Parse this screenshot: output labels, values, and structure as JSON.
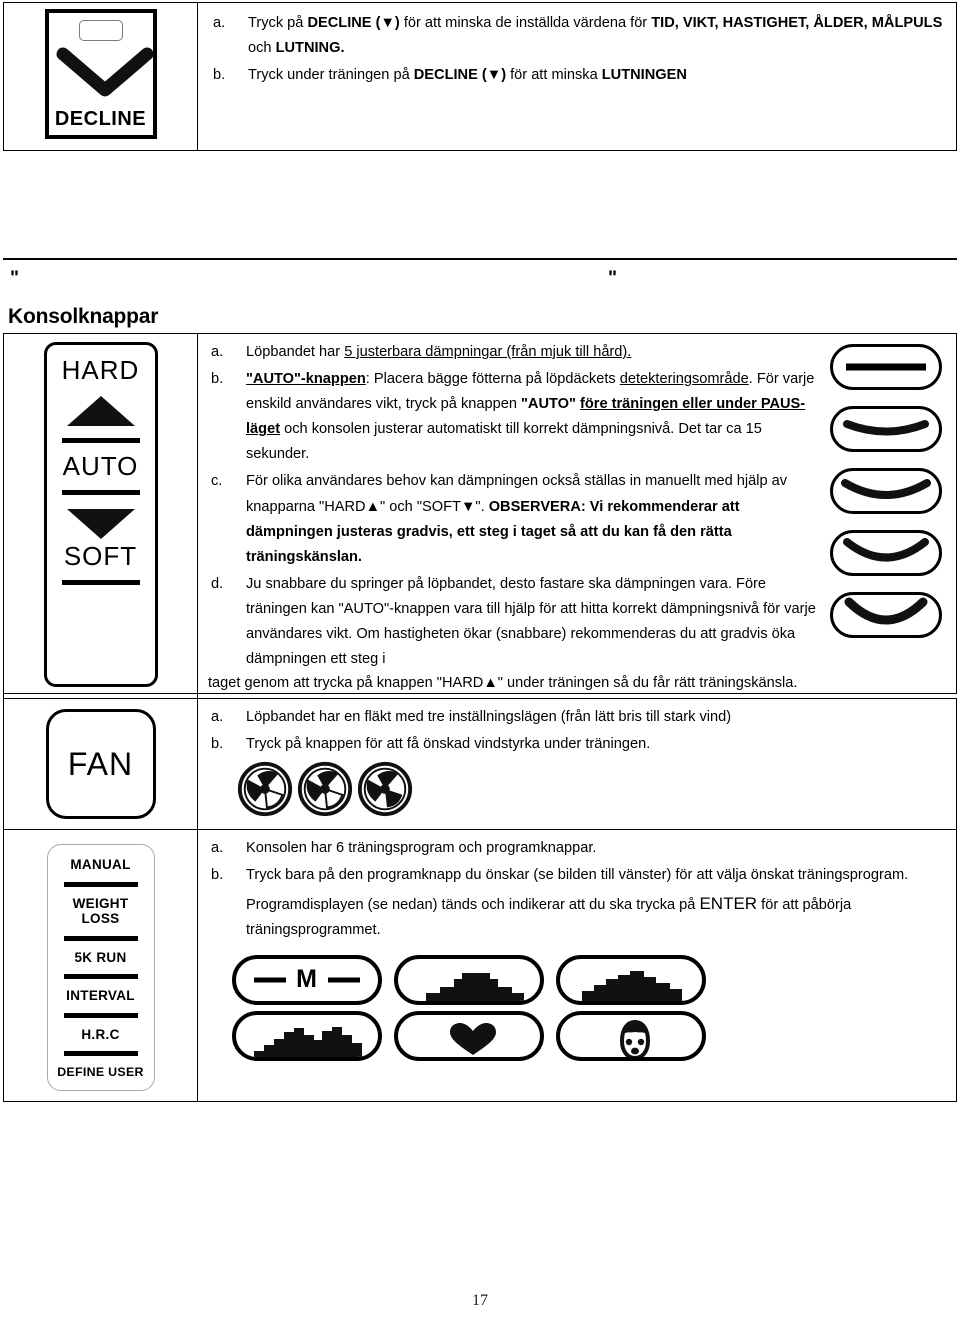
{
  "page": {
    "number": "17",
    "section_heading": "Konsolknappar",
    "quote_left": "\"",
    "quote_right": "\""
  },
  "decline_section": {
    "key_label": "DECLINE",
    "icon": "chevron-down-glyph",
    "items": [
      {
        "mark": "a.",
        "parts": [
          {
            "t": "Tryck på ",
            "b": false
          },
          {
            "t": "DECLINE (",
            "b": true
          },
          {
            "t": "▼",
            "b": true
          },
          {
            "t": ") ",
            "b": true
          },
          {
            "t": "för att minska de inställda värdena för ",
            "b": false
          },
          {
            "t": "TID, VIKT, HASTIGHET, ÅLDER, MÅLPULS",
            "b": true
          },
          {
            "t": " och ",
            "b": false
          },
          {
            "t": "LUTNING.",
            "b": true
          }
        ]
      },
      {
        "mark": "b.",
        "parts": [
          {
            "t": "Tryck under träningen på ",
            "b": false
          },
          {
            "t": "DECLINE (",
            "b": true
          },
          {
            "t": "▼",
            "b": true
          },
          {
            "t": ") ",
            "b": true
          },
          {
            "t": "för att minska ",
            "b": false
          },
          {
            "t": "LUTNINGEN",
            "b": true
          }
        ]
      }
    ]
  },
  "cushion_section": {
    "key": {
      "hard_label": "HARD",
      "auto_label": "AUTO",
      "soft_label": "SOFT",
      "up_icon": "triangle-up-icon",
      "down_icon": "triangle-down-icon"
    },
    "levels": [
      {
        "name": "cushion-level-1-flat"
      },
      {
        "name": "cushion-level-2"
      },
      {
        "name": "cushion-level-3"
      },
      {
        "name": "cushion-level-4"
      },
      {
        "name": "cushion-level-5-soft"
      }
    ],
    "items": [
      {
        "mark": "a.",
        "parts": [
          {
            "t": "Löpbandet har ",
            "b": false
          },
          {
            "t": "5 justerbara dämpningar (från mjuk till hård).",
            "b": false,
            "u": true
          }
        ]
      },
      {
        "mark": "b.",
        "parts": [
          {
            "t": "\"AUTO\"-knappen",
            "b": true,
            "u": true
          },
          {
            "t": ": Placera bägge fötterna på löpdäckets ",
            "b": false
          },
          {
            "t": "detekteringsområde",
            "b": false,
            "u": true
          },
          {
            "t": ". För varje enskild användares vikt, tryck på knappen ",
            "b": false
          },
          {
            "t": "\"AUTO\" ",
            "b": true
          },
          {
            "t": "före träningen eller under PAUS-läget",
            "b": true,
            "u": true
          },
          {
            "t": " och konsolen justerar automatiskt till korrekt dämpningsnivå. Det tar ca 15 sekunder.",
            "b": false
          }
        ]
      },
      {
        "mark": "c.",
        "parts": [
          {
            "t": "För olika användares behov kan dämpningen också ställas in manuellt med hjälp av knapparna \"HARD",
            "b": false
          },
          {
            "t": "▲",
            "b": false
          },
          {
            "t": "\" och \"SOFT",
            "b": false
          },
          {
            "t": "▼",
            "b": false
          },
          {
            "t": "\". ",
            "b": false
          },
          {
            "t": "OBSERVERA: Vi rekommenderar att dämpningen justeras gradvis, ett steg i taget så att du kan få den rätta träningskänslan.",
            "b": true
          }
        ]
      },
      {
        "mark": "d.",
        "parts": [
          {
            "t": "Ju snabbare du springer på löpbandet, desto fastare ska dämpningen vara. Före träningen kan \"AUTO\"-knappen vara till hjälp för att hitta korrekt dämpningsnivå för varje användares vikt. Om hastigheten ökar (snabbare) rekommenderas du att gradvis öka dämpningen ett steg i ",
            "b": false
          }
        ]
      }
    ],
    "overflow_line": {
      "parts": [
        {
          "t": "taget genom att trycka på knappen \"HARD",
          "b": false
        },
        {
          "t": "▲",
          "b": false
        },
        {
          "t": "\" under träningen så du får rätt träningskänsla.",
          "b": false
        }
      ]
    }
  },
  "fan_section": {
    "key_label": "FAN",
    "icons": [
      "fan-speed-1-icon",
      "fan-speed-2-icon",
      "fan-speed-3-icon"
    ],
    "items": [
      {
        "mark": "a.",
        "parts": [
          {
            "t": "Löpbandet har en fläkt med tre inställningslägen (från lätt bris till stark vind)",
            "b": false
          }
        ]
      },
      {
        "mark": "b.",
        "parts": [
          {
            "t": "Tryck på knappen för att få önskad vindstyrka under träningen.",
            "b": false
          }
        ]
      }
    ]
  },
  "program_section": {
    "key_labels": [
      "MANUAL",
      "WEIGHT\nLOSS",
      "5K RUN",
      "INTERVAL",
      "H.R.C",
      "DEFINE USER"
    ],
    "program_buttons": [
      {
        "name": "program-manual-button",
        "icon": "dash-M-dash"
      },
      {
        "name": "program-hill-button",
        "icon": "plateau-profile"
      },
      {
        "name": "program-mountain-button",
        "icon": "stepped-peak-profile"
      },
      {
        "name": "program-interval-button",
        "icon": "twin-peak-profile"
      },
      {
        "name": "program-hrc-button",
        "icon": "heart-icon"
      },
      {
        "name": "program-user-button",
        "icon": "user-face-icon"
      }
    ],
    "items": [
      {
        "mark": "a.",
        "parts": [
          {
            "t": "Konsolen har 6 träningsprogram och programknappar.",
            "b": false
          }
        ]
      },
      {
        "mark": "b.",
        "parts": [
          {
            "t": "Tryck bara på den programknapp du önskar (se bilden till vänster) för att välja önskat träningsprogram. Programdisplayen (se nedan) tänds och indikerar att du ska trycka på ",
            "b": false
          },
          {
            "t": "ENTER",
            "b": false,
            "big": true
          },
          {
            "t": " för att påbörja träningsprogrammet.",
            "b": false
          }
        ]
      }
    ]
  }
}
